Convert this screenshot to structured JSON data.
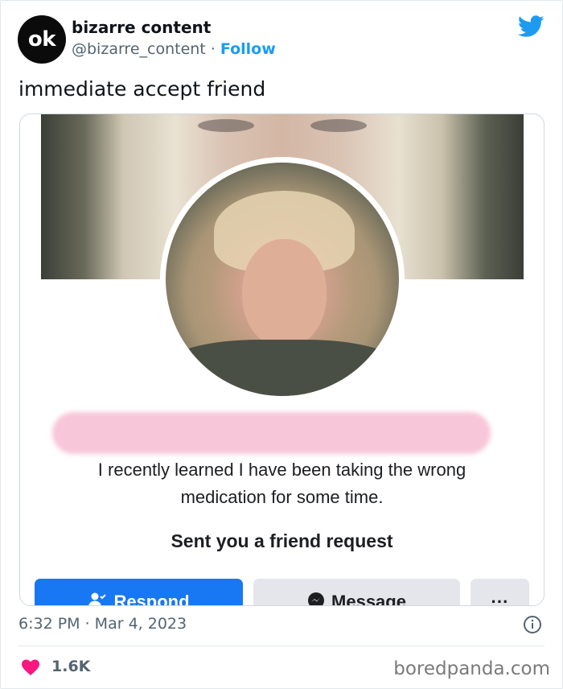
{
  "tweet": {
    "avatar_text": "ok",
    "display_name": "bizarre content",
    "handle": "@bizarre_content",
    "separator": " · ",
    "follow_label": "Follow",
    "text": "immediate accept friend",
    "timestamp": "6:32 PM · Mar 4, 2023",
    "likes": "1.6K"
  },
  "friend_request": {
    "bio_line1": "I recently learned I have been taking the wrong",
    "bio_line2": "medication for some time.",
    "request_text": "Sent you a friend request",
    "respond_label": "Respond",
    "message_label": "Message",
    "more_label": "···"
  },
  "watermark": "boredpanda.com",
  "colors": {
    "twitter_blue": "#1d9bf0",
    "facebook_blue": "#1877f2",
    "like_pink": "#f91880",
    "muted_text": "#536471"
  },
  "icons": [
    "twitter-bird-icon",
    "add-friend-icon",
    "messenger-icon",
    "info-icon",
    "heart-icon"
  ]
}
